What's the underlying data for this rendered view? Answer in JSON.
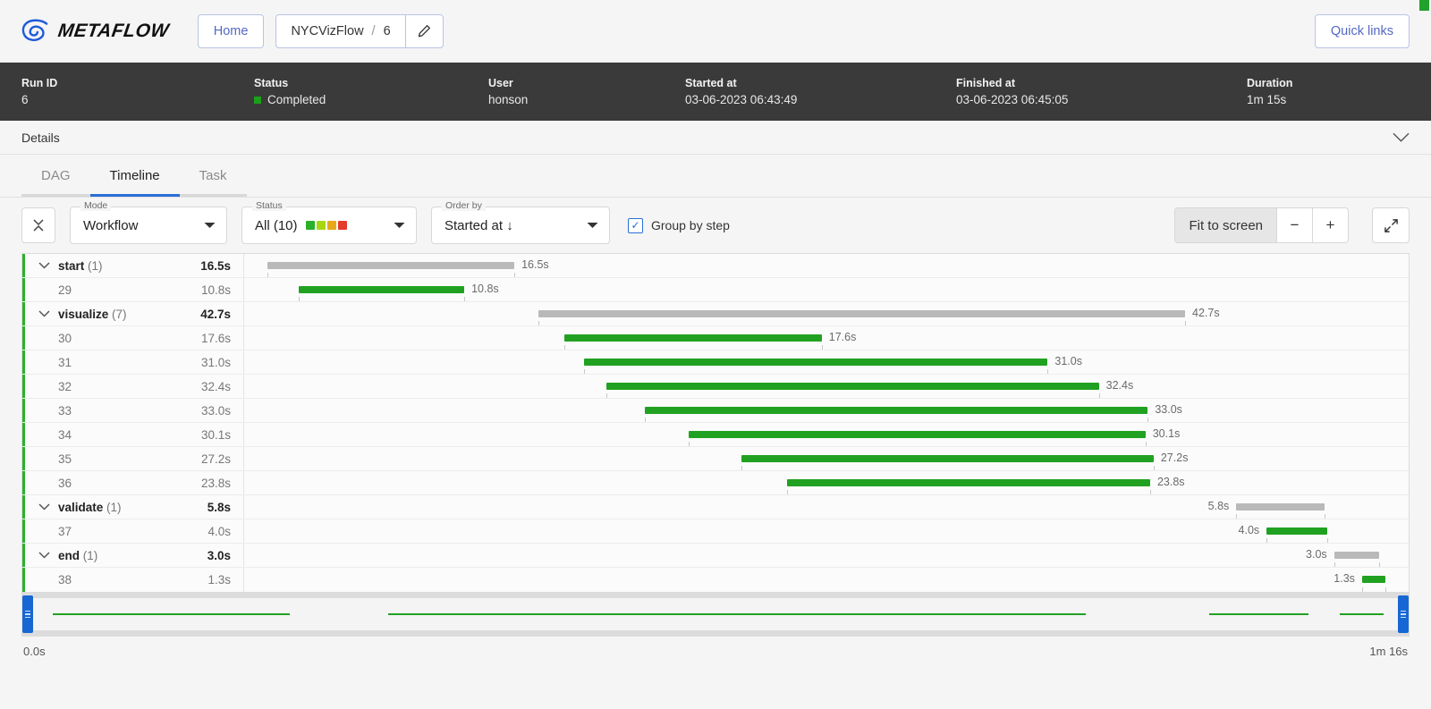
{
  "topnav": {
    "brand": "METAFLOW",
    "home_label": "Home",
    "flow_name": "NYCVizFlow",
    "crumb_separator": "/",
    "run_id": "6",
    "edit_icon": "pencil-icon",
    "quick_links_label": "Quick links"
  },
  "runbar": {
    "cells": [
      {
        "label": "Run ID",
        "value": "6"
      },
      {
        "label": "Status",
        "value": "Completed",
        "dot_color": "#1aa11a"
      },
      {
        "label": "User",
        "value": "honson"
      },
      {
        "label": "Started at",
        "value": "03-06-2023 06:43:49"
      },
      {
        "label": "Finished at",
        "value": "03-06-2023 06:45:05"
      },
      {
        "label": "Duration",
        "value": "1m 15s"
      }
    ]
  },
  "details": {
    "title": "Details",
    "chevron": "chevron-down-icon"
  },
  "tabs": [
    {
      "label": "DAG",
      "active": false
    },
    {
      "label": "Timeline",
      "active": true
    },
    {
      "label": "Task",
      "active": false
    }
  ],
  "controls": {
    "collapse_icon": "collapse-rows-icon",
    "mode": {
      "legend": "Mode",
      "value": "Workflow"
    },
    "status": {
      "legend": "Status",
      "value": "All (10)",
      "swatches": [
        "#2bb02b",
        "#a8d613",
        "#e8a81c",
        "#e33b2e"
      ]
    },
    "order_by": {
      "legend": "Order by",
      "value": "Started at ↓"
    },
    "group_by_step": {
      "label": "Group by step",
      "checked": true,
      "check_glyph": "✓"
    },
    "fit_to_screen": "Fit to screen",
    "zoom_out": "−",
    "zoom_in": "+",
    "expand_icon": "expand-fullscreen-icon"
  },
  "timeline": {
    "rows": [
      {
        "type": "group",
        "twisty": "chevron-down-icon",
        "name": "start",
        "count": "(1)",
        "duration": "16.5s",
        "bar": "gray",
        "start_pct": 2.0,
        "end_pct": 23.2,
        "label_side": "right"
      },
      {
        "type": "task",
        "twisty": "",
        "name": "29",
        "count": "",
        "duration": "10.8s",
        "bar": "green",
        "start_pct": 4.7,
        "end_pct": 18.9,
        "label_side": "right"
      },
      {
        "type": "group",
        "twisty": "chevron-down-icon",
        "name": "visualize",
        "count": "(7)",
        "duration": "42.7s",
        "bar": "gray",
        "start_pct": 25.3,
        "end_pct": 80.8,
        "label_side": "right"
      },
      {
        "type": "task",
        "twisty": "",
        "name": "30",
        "count": "",
        "duration": "17.6s",
        "bar": "green",
        "start_pct": 27.5,
        "end_pct": 49.6,
        "label_side": "right"
      },
      {
        "type": "task",
        "twisty": "",
        "name": "31",
        "count": "",
        "duration": "31.0s",
        "bar": "green",
        "start_pct": 29.2,
        "end_pct": 69.0,
        "label_side": "right"
      },
      {
        "type": "task",
        "twisty": "",
        "name": "32",
        "count": "",
        "duration": "32.4s",
        "bar": "green",
        "start_pct": 31.1,
        "end_pct": 73.4,
        "label_side": "right"
      },
      {
        "type": "task",
        "twisty": "",
        "name": "33",
        "count": "",
        "duration": "33.0s",
        "bar": "green",
        "start_pct": 34.4,
        "end_pct": 77.6,
        "label_side": "right"
      },
      {
        "type": "task",
        "twisty": "",
        "name": "34",
        "count": "",
        "duration": "30.1s",
        "bar": "green",
        "start_pct": 38.2,
        "end_pct": 77.4,
        "label_side": "right"
      },
      {
        "type": "task",
        "twisty": "",
        "name": "35",
        "count": "",
        "duration": "27.2s",
        "bar": "green",
        "start_pct": 42.7,
        "end_pct": 78.1,
        "label_side": "right"
      },
      {
        "type": "task",
        "twisty": "",
        "name": "36",
        "count": "",
        "duration": "23.8s",
        "bar": "green",
        "start_pct": 46.6,
        "end_pct": 77.8,
        "label_side": "right"
      },
      {
        "type": "group",
        "twisty": "chevron-down-icon",
        "name": "validate",
        "count": "(1)",
        "duration": "5.8s",
        "bar": "gray",
        "start_pct": 85.2,
        "end_pct": 92.8,
        "label_side": "left"
      },
      {
        "type": "task",
        "twisty": "",
        "name": "37",
        "count": "",
        "duration": "4.0s",
        "bar": "green",
        "start_pct": 87.8,
        "end_pct": 93.0,
        "label_side": "left"
      },
      {
        "type": "group",
        "twisty": "chevron-down-icon",
        "name": "end",
        "count": "(1)",
        "duration": "3.0s",
        "bar": "gray",
        "start_pct": 93.6,
        "end_pct": 97.5,
        "label_side": "left"
      },
      {
        "type": "task",
        "twisty": "",
        "name": "38",
        "count": "",
        "duration": "1.3s",
        "bar": "green",
        "start_pct": 96.0,
        "end_pct": 98.0,
        "label_side": "left"
      }
    ]
  },
  "minimap": {
    "lines": [
      {
        "start_pct": 2.2,
        "end_pct": 19.3
      },
      {
        "start_pct": 26.4,
        "end_pct": 76.7
      },
      {
        "start_pct": 85.6,
        "end_pct": 92.8
      },
      {
        "start_pct": 95.0,
        "end_pct": 98.2
      }
    ],
    "handle_left_pct": 0.0,
    "handle_right_pct": 100.0,
    "scale_start": "0.0s",
    "scale_end": "1m 16s"
  }
}
